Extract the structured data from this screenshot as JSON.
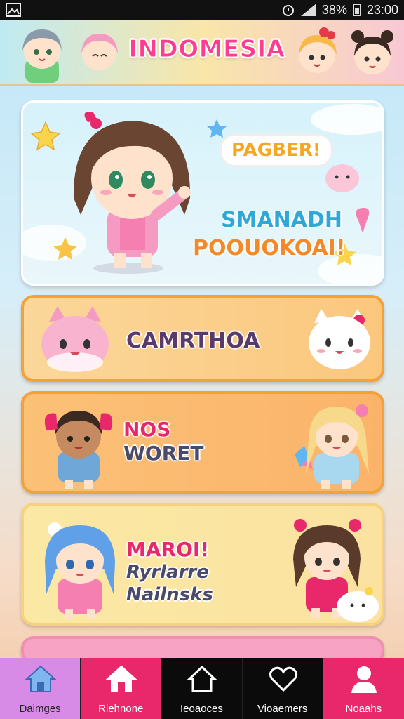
{
  "status_bar": {
    "battery": "38%",
    "time": "23:00"
  },
  "header": {
    "title": "INDOMESIA"
  },
  "hero": {
    "bubble": "PAGBER!",
    "line1": "SMANADH",
    "line2": "POOUOKOAI!"
  },
  "cards": [
    {
      "text": "CAMRTHOA"
    },
    {
      "line1": "NOS",
      "line2": "WORET"
    },
    {
      "line1": "MAROI!",
      "line2": "Ryrlarre",
      "line3": "Nailnsks"
    }
  ],
  "bottom_nav": [
    {
      "label": "Daimges",
      "icon": "home-icon",
      "color": "#d88be6"
    },
    {
      "label": "Riehnone",
      "icon": "house-icon",
      "color": "#e8286a"
    },
    {
      "label": "Ieoaoces",
      "icon": "house-outline-icon",
      "color": "#0b0b0b"
    },
    {
      "label": "Vioaemers",
      "icon": "heart-icon",
      "color": "#0b0b0b"
    },
    {
      "label": "Noaahs",
      "icon": "person-icon",
      "color": "#e8286a"
    }
  ],
  "colors": {
    "title_pink": "#ff3d8e",
    "card_border": "#f3a13a"
  }
}
